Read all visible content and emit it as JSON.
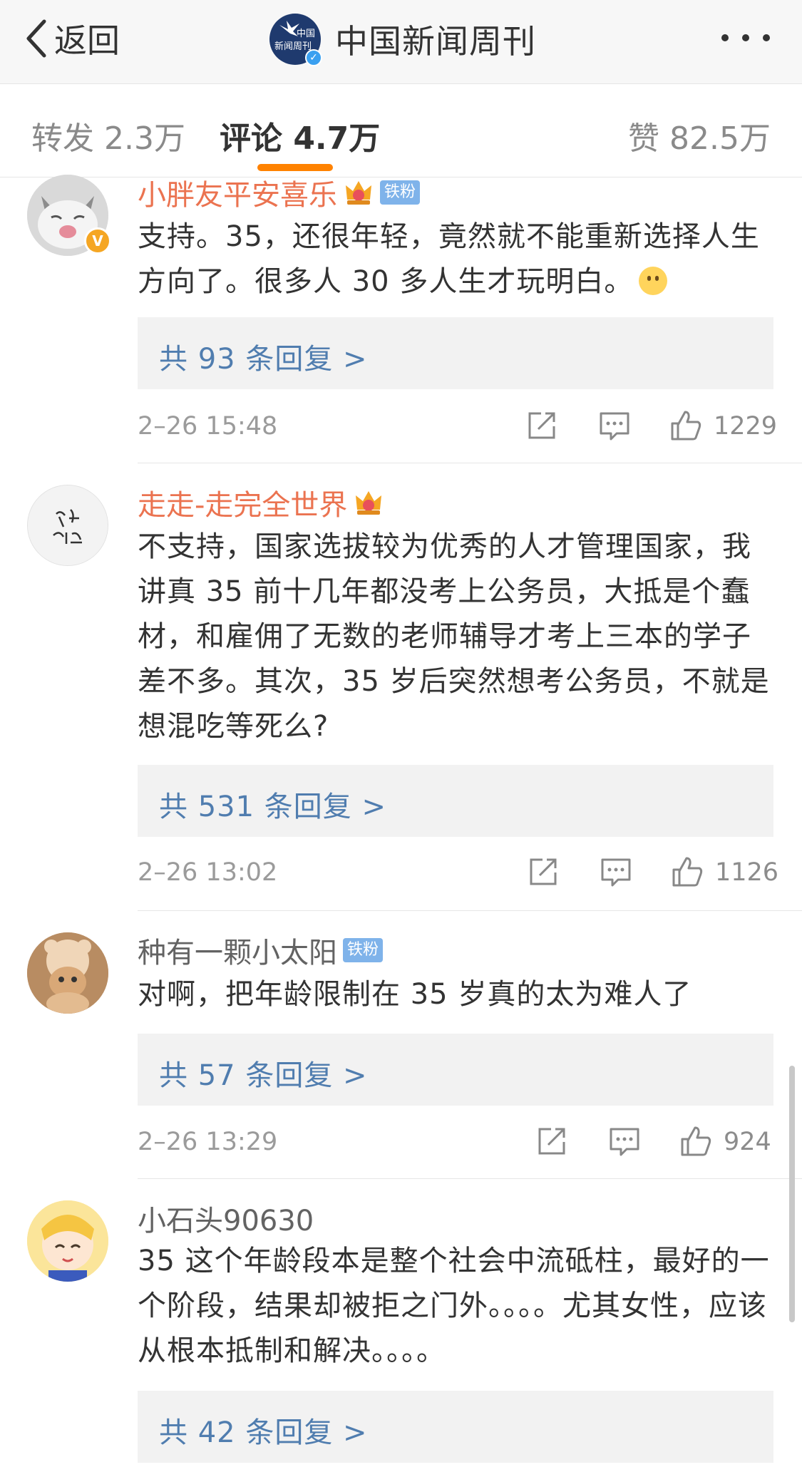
{
  "header": {
    "back_label": "返回",
    "title": "中国新闻周刊",
    "logo_text_top": "中国",
    "logo_text_bottom": "新闻周刊"
  },
  "tabs": {
    "repost": "转发 2.3万",
    "comments": "评论 4.7万",
    "likes": "赞 82.5万"
  },
  "colors": {
    "accent": "#ff8200",
    "link_blue": "#507daf",
    "username_orange": "#eb7350",
    "badge_blue": "#7fb3ea"
  },
  "comments": [
    {
      "username": "小胖友平安喜乐",
      "badge": "铁粉",
      "text": "支持。35，还很年轻，竟然就不能重新选择人生方向了。很多人 30 多人生才玩明白。",
      "replies": "共 93 条回复 >",
      "time": "2–26 15:48",
      "likes": "1229"
    },
    {
      "username": "走走-走完全世界",
      "text": "不支持，国家选拔较为优秀的人才管理国家，我讲真 35 前十几年都没考上公务员，大抵是个蠢材，和雇佣了无数的老师辅导才考上三本的学子差不多。其次，35 岁后突然想考公务员，不就是想混吃等死么?",
      "replies": "共 531 条回复 >",
      "time": "2–26 13:02",
      "likes": "1126"
    },
    {
      "username": "种有一颗小太阳",
      "badge": "铁粉",
      "text": "对啊，把年龄限制在 35 岁真的太为难人了",
      "replies": "共 57 条回复 >",
      "time": "2–26 13:29",
      "likes": "924"
    },
    {
      "username": "小石头90630",
      "text": "35 这个年龄段本是整个社会中流砥柱，最好的一个阶段，结果却被拒之门外。。。。尤其女性，应该从根本抵制和解决。。。。",
      "replies": "共 42 条回复 >"
    }
  ]
}
